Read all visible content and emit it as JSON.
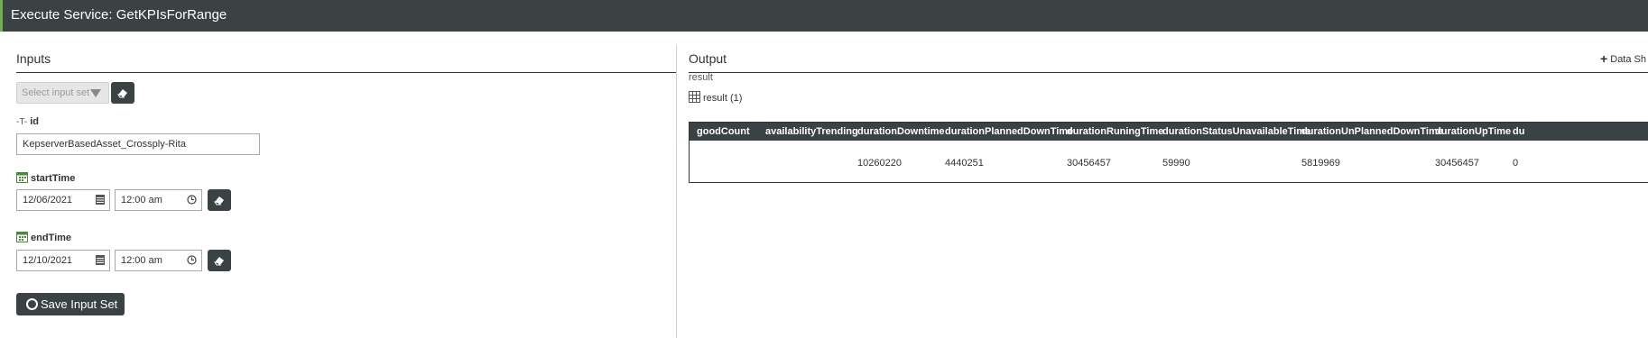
{
  "title": "Execute Service: GetKPIsForRange",
  "inputs": {
    "heading": "Inputs",
    "input_set_placeholder": "Select input set",
    "id": {
      "label": "id",
      "value": "KepserverBasedAsset_Crossply-Rita"
    },
    "startTime": {
      "label": "startTime",
      "date": "12/06/2021",
      "time": "12:00 am"
    },
    "endTime": {
      "label": "endTime",
      "date": "12/10/2021",
      "time": "12:00 am"
    },
    "save_label": "Save Input Set"
  },
  "output": {
    "heading": "Output",
    "data_shape_label": "Data Sh",
    "result_label": "result",
    "result_count": "result (1)",
    "columns": [
      "goodCount",
      "availabilityTrending",
      "durationDowntime",
      "durationPlannedDownTime",
      "durationRuningTime",
      "durationStatusUnavailableTime",
      "durationUnPlannedDownTime",
      "durationUpTime",
      "du"
    ],
    "rows": [
      [
        "",
        "",
        "10260220",
        "4440251",
        "30456457",
        "59990",
        "5819969",
        "30456457",
        "0"
      ]
    ]
  },
  "colors": {
    "header_bg": "#3a4244",
    "accent": "#6cb33f"
  }
}
